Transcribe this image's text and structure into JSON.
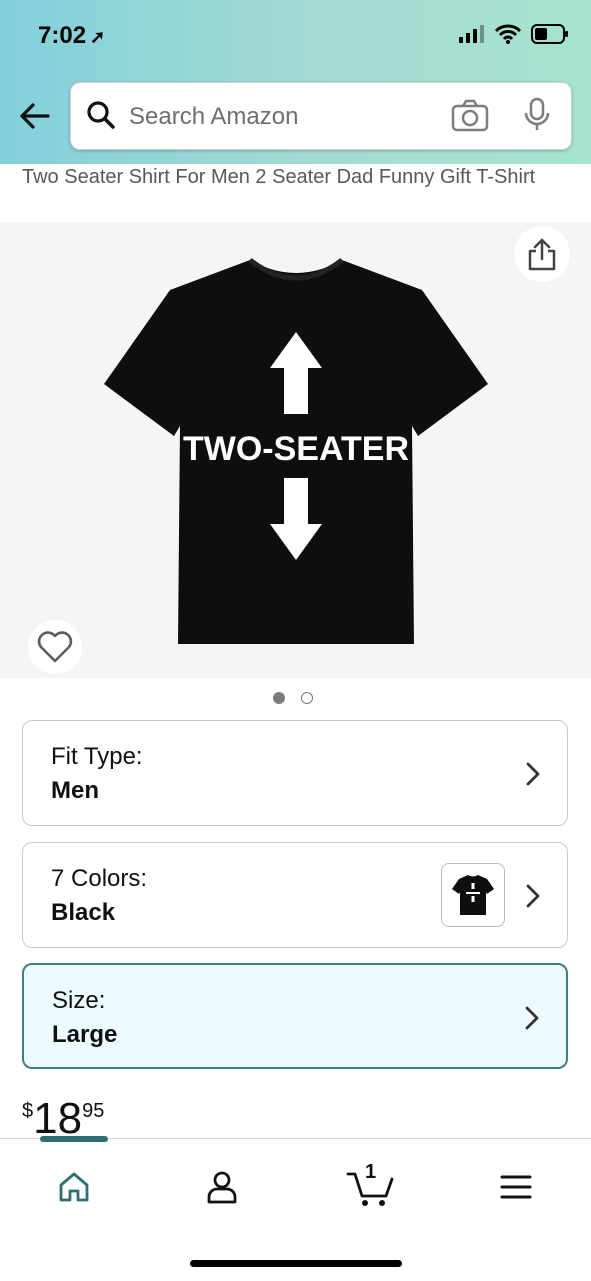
{
  "status_bar": {
    "time": "7:02",
    "location_icon": "location-arrow-icon",
    "signal_icon": "cellular-signal-icon",
    "wifi_icon": "wifi-icon",
    "battery_icon": "battery-icon"
  },
  "search": {
    "placeholder": "Search Amazon",
    "back_icon": "back-arrow-icon",
    "search_icon": "search-icon",
    "camera_icon": "camera-icon",
    "mic_icon": "microphone-icon"
  },
  "product": {
    "title": "Two Seater Shirt For Men 2 Seater Dad Funny Gift T-Shirt",
    "shirt_text": "TWO-SEATER",
    "image_count": 2,
    "active_image": 1
  },
  "options": [
    {
      "label": "Fit Type:",
      "value": "Men"
    },
    {
      "label": "7 Colors:",
      "value": "Black"
    },
    {
      "label": "Size:",
      "value": "Large"
    }
  ],
  "price": {
    "currency": "$",
    "whole": "18",
    "fraction": "95"
  },
  "bottom_nav": {
    "items": [
      "home-icon",
      "account-icon",
      "cart-icon",
      "menu-icon"
    ],
    "cart_count": "1"
  },
  "colors": {
    "accent": "#2d6f77",
    "header_start": "#82d0dc",
    "header_end": "#a6e3d0",
    "selected_bg": "#edfafe"
  }
}
